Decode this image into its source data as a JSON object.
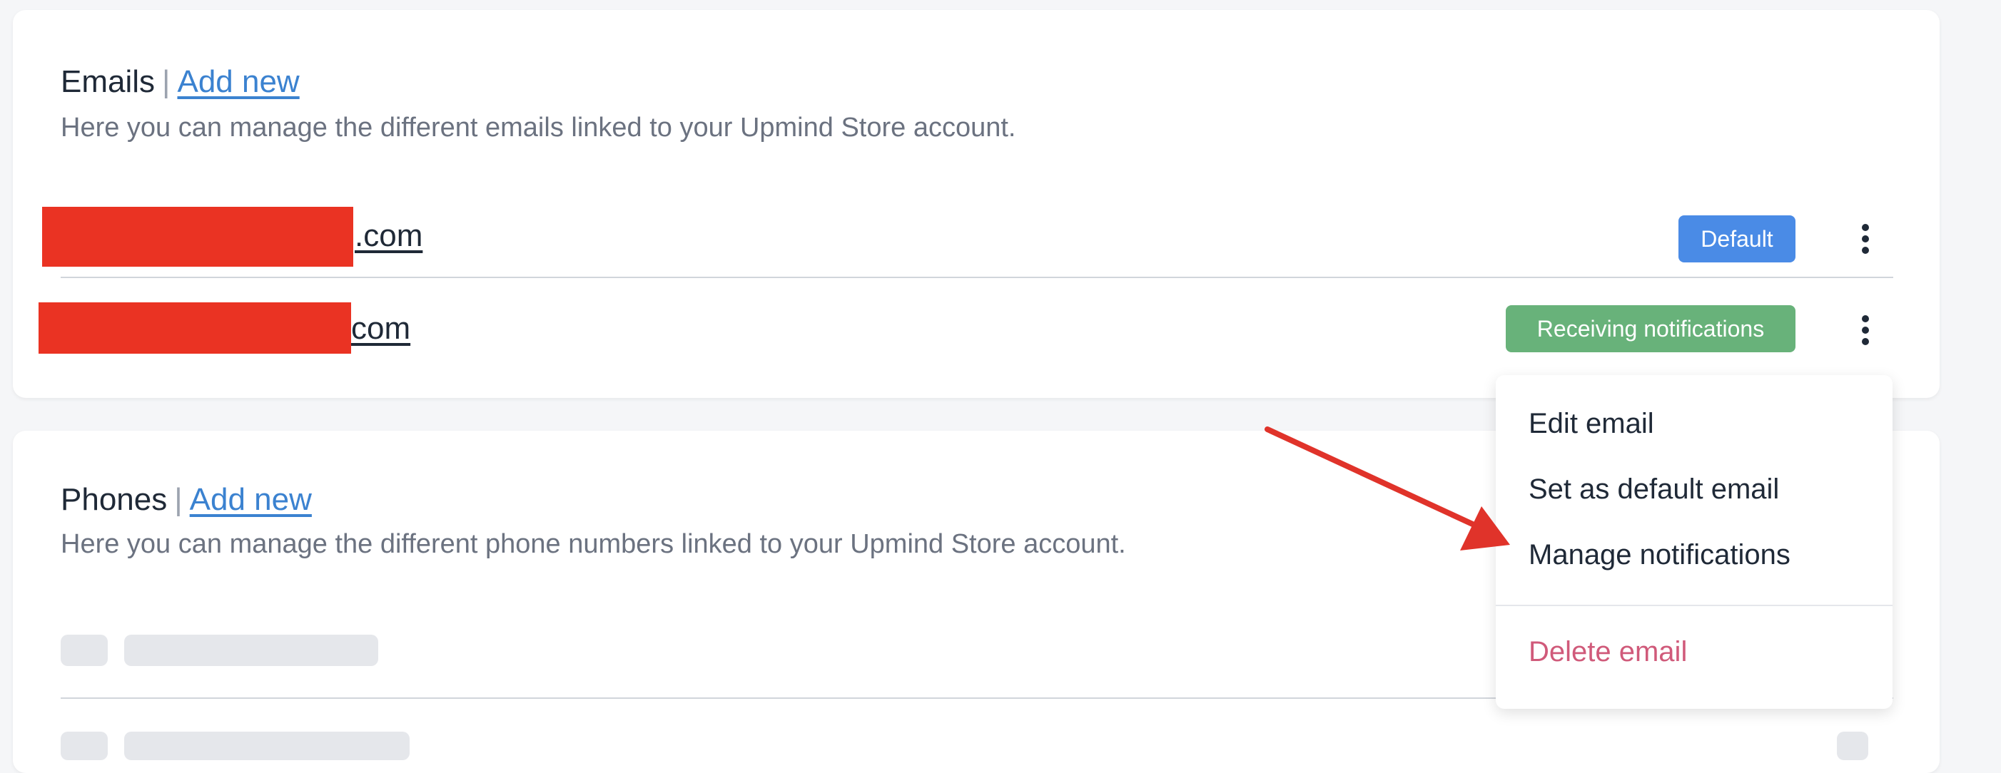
{
  "emails": {
    "title": "Emails",
    "separator": "|",
    "add_new": "Add new",
    "description": "Here you can manage the different emails linked to your Upmind Store account.",
    "rows": [
      {
        "suffix": ".com",
        "badge": "Default",
        "badge_color": "#4a8be6"
      },
      {
        "suffix": "com",
        "badge": "Receiving notifications",
        "badge_color": "#68b27a"
      }
    ]
  },
  "menu": {
    "items": [
      "Edit email",
      "Set as default email",
      "Manage notifications"
    ],
    "danger_item": "Delete email",
    "danger_color": "#d05a7a"
  },
  "phones": {
    "title": "Phones",
    "separator": "|",
    "add_new": "Add new",
    "description": "Here you can manage the different phone numbers linked to your Upmind Store account."
  },
  "colors": {
    "link": "#3b82d0",
    "redaction": "#ea3323",
    "annotation_arrow": "#e0332a"
  }
}
